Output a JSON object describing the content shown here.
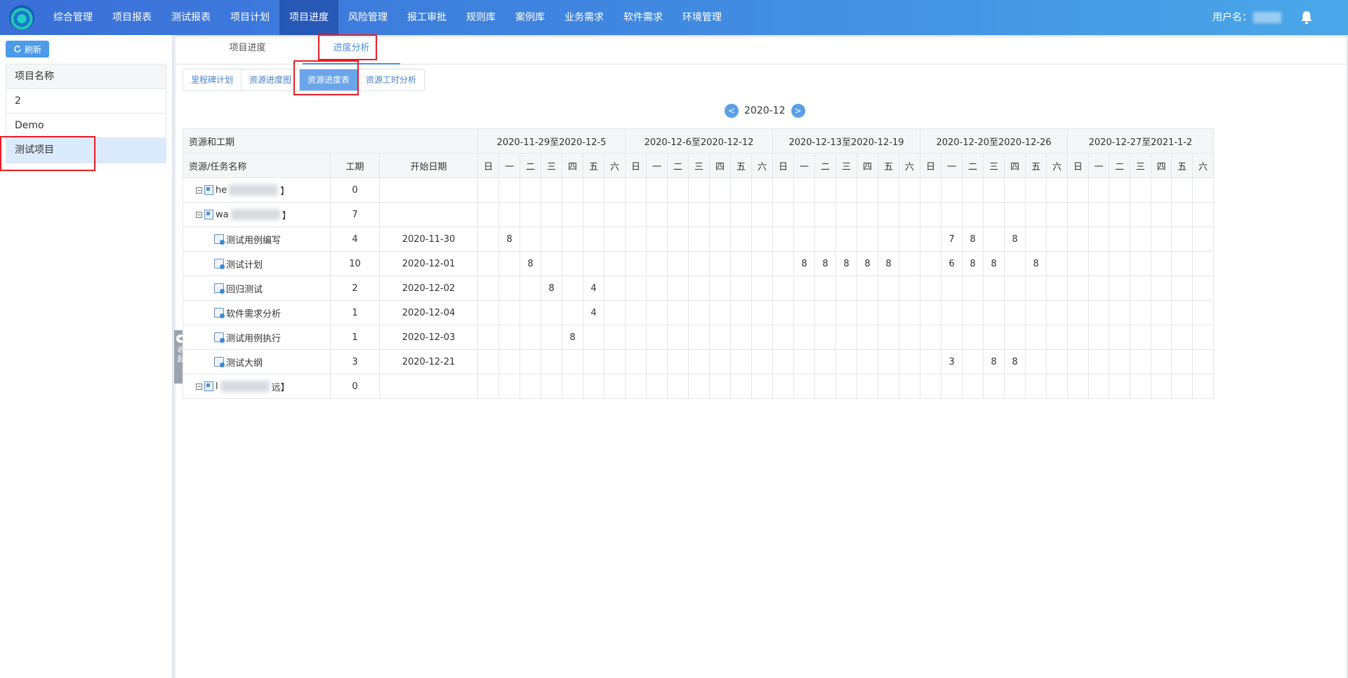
{
  "nav": {
    "items": [
      "综合管理",
      "项目报表",
      "测试报表",
      "项目计划",
      "项目进度",
      "风险管理",
      "报工审批",
      "规则库",
      "案例库",
      "业务需求",
      "软件需求",
      "环境管理"
    ],
    "active_index": 4,
    "user_label": "用户名：",
    "bell_icon": "bell-icon"
  },
  "sidebar": {
    "refresh_label": "刷新",
    "header": "项目名称",
    "projects": [
      "2",
      "Demo",
      "测试项目"
    ],
    "selected_index": 2,
    "collapse_label": "收起"
  },
  "tabs": [
    "项目进度",
    "进度分析"
  ],
  "active_tab_index": 1,
  "subtabs": [
    "里程碑计划",
    "资源进度图",
    "资源进度表",
    "资源工时分析"
  ],
  "active_subtab_index": 2,
  "month": {
    "prev": "<",
    "label": "2020-12",
    "next": ">"
  },
  "table": {
    "group_header": "资源和工期",
    "col_name": "资源/任务名称",
    "col_duration": "工期",
    "col_start": "开始日期",
    "weeks": [
      "2020-11-29至2020-12-5",
      "2020-12-6至2020-12-12",
      "2020-12-13至2020-12-19",
      "2020-12-20至2020-12-26",
      "2020-12-27至2021-1-2"
    ],
    "weekdays": [
      "日",
      "一",
      "二",
      "三",
      "四",
      "五",
      "六"
    ],
    "rows": [
      {
        "type": "resource",
        "prefix": "he",
        "suffix": "】",
        "duration": "0",
        "start": "",
        "cells": {}
      },
      {
        "type": "resource",
        "prefix": "wa",
        "suffix": "】",
        "duration": "7",
        "start": "",
        "cells": {}
      },
      {
        "type": "task",
        "name": "测试用例编写",
        "duration": "4",
        "start": "2020-11-30",
        "cells": {
          "1": "8",
          "22": "7",
          "23": "8",
          "25": "8"
        }
      },
      {
        "type": "task",
        "name": "测试计划",
        "duration": "10",
        "start": "2020-12-01",
        "cells": {
          "2": "8",
          "15": "8",
          "16": "8",
          "17": "8",
          "18": "8",
          "19": "8",
          "22": "6",
          "23": "8",
          "24": "8",
          "26": "8"
        }
      },
      {
        "type": "task",
        "name": "回归测试",
        "duration": "2",
        "start": "2020-12-02",
        "cells": {
          "3": "8",
          "5": "4"
        }
      },
      {
        "type": "task",
        "name": "软件需求分析",
        "duration": "1",
        "start": "2020-12-04",
        "cells": {
          "5": "4"
        }
      },
      {
        "type": "task",
        "name": "测试用例执行",
        "duration": "1",
        "start": "2020-12-03",
        "cells": {
          "4": "8"
        }
      },
      {
        "type": "task",
        "name": "测试大纲",
        "duration": "3",
        "start": "2020-12-21",
        "cells": {
          "22": "3",
          "24": "8",
          "25": "8"
        }
      },
      {
        "type": "resource",
        "prefix": "l",
        "suffix": "远】",
        "duration": "0",
        "start": "",
        "cells": {}
      }
    ]
  }
}
